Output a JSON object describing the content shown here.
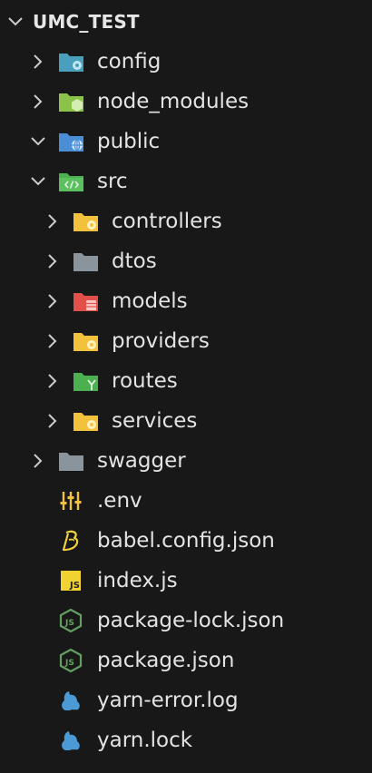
{
  "explorer": {
    "root": {
      "label": "UMC_TEST",
      "expanded": true
    },
    "items": [
      {
        "label": "config",
        "icon": "folder-config-icon",
        "expanded": false
      },
      {
        "label": "node_modules",
        "icon": "folder-node-icon",
        "expanded": false
      },
      {
        "label": "public",
        "icon": "folder-public-icon",
        "expanded": true
      },
      {
        "label": "src",
        "icon": "folder-src-icon",
        "expanded": true
      },
      {
        "label": "controllers",
        "icon": "folder-controllers-icon",
        "expanded": false
      },
      {
        "label": "dtos",
        "icon": "folder-icon",
        "expanded": false
      },
      {
        "label": "models",
        "icon": "folder-models-icon",
        "expanded": false
      },
      {
        "label": "providers",
        "icon": "folder-providers-icon",
        "expanded": false
      },
      {
        "label": "routes",
        "icon": "folder-routes-icon",
        "expanded": false
      },
      {
        "label": "services",
        "icon": "folder-services-icon",
        "expanded": false
      },
      {
        "label": "swagger",
        "icon": "folder-icon",
        "expanded": false
      },
      {
        "label": ".env",
        "icon": "env-file-icon"
      },
      {
        "label": "babel.config.json",
        "icon": "babel-icon"
      },
      {
        "label": "index.js",
        "icon": "javascript-icon"
      },
      {
        "label": "package-lock.json",
        "icon": "nodejs-icon"
      },
      {
        "label": "package.json",
        "icon": "nodejs-icon"
      },
      {
        "label": "yarn-error.log",
        "icon": "yarn-icon"
      },
      {
        "label": "yarn.lock",
        "icon": "yarn-icon"
      }
    ]
  },
  "colors": {
    "background": "#181818",
    "text": "#e3e3e3",
    "chevron": "#cccccc",
    "folder_blue": "#4a9fbc",
    "folder_green": "#8bc34a",
    "folder_public": "#4a8fd6",
    "folder_src": "#4caf50",
    "folder_yellow": "#f3c23c",
    "folder_gray": "#8a949c",
    "folder_red": "#e2504a",
    "js_yellow": "#f0d230",
    "node_green": "#66a060",
    "yarn_blue": "#4b9ad6"
  }
}
